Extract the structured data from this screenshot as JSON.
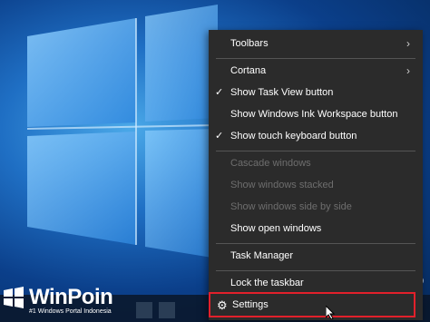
{
  "context_menu": {
    "items": [
      {
        "label": "Toolbars",
        "checked": false,
        "submenu": true,
        "disabled": false
      },
      {
        "label": "Cortana",
        "checked": false,
        "submenu": true,
        "disabled": false
      },
      {
        "label": "Show Task View button",
        "checked": true,
        "submenu": false,
        "disabled": false
      },
      {
        "label": "Show Windows Ink Workspace button",
        "checked": false,
        "submenu": false,
        "disabled": false
      },
      {
        "label": "Show touch keyboard button",
        "checked": true,
        "submenu": false,
        "disabled": false
      },
      {
        "label": "Cascade windows",
        "checked": false,
        "submenu": false,
        "disabled": true
      },
      {
        "label": "Show windows stacked",
        "checked": false,
        "submenu": false,
        "disabled": true
      },
      {
        "label": "Show windows side by side",
        "checked": false,
        "submenu": false,
        "disabled": true
      },
      {
        "label": "Show open windows",
        "checked": false,
        "submenu": false,
        "disabled": false
      },
      {
        "label": "Task Manager",
        "checked": false,
        "submenu": false,
        "disabled": false
      },
      {
        "label": "Lock the taskbar",
        "checked": false,
        "submenu": false,
        "disabled": false
      },
      {
        "label": "Settings",
        "checked": false,
        "submenu": false,
        "disabled": false
      }
    ],
    "check_glyph": "✓",
    "chevron_glyph": "›",
    "gear_icon": "gear-icon",
    "highlight_color": "#e2202b"
  },
  "watermark": {
    "title": "WinPoin",
    "subtitle": "#1 Windows Portal Indonesia"
  },
  "taskbar": {
    "edge_text": "30"
  }
}
